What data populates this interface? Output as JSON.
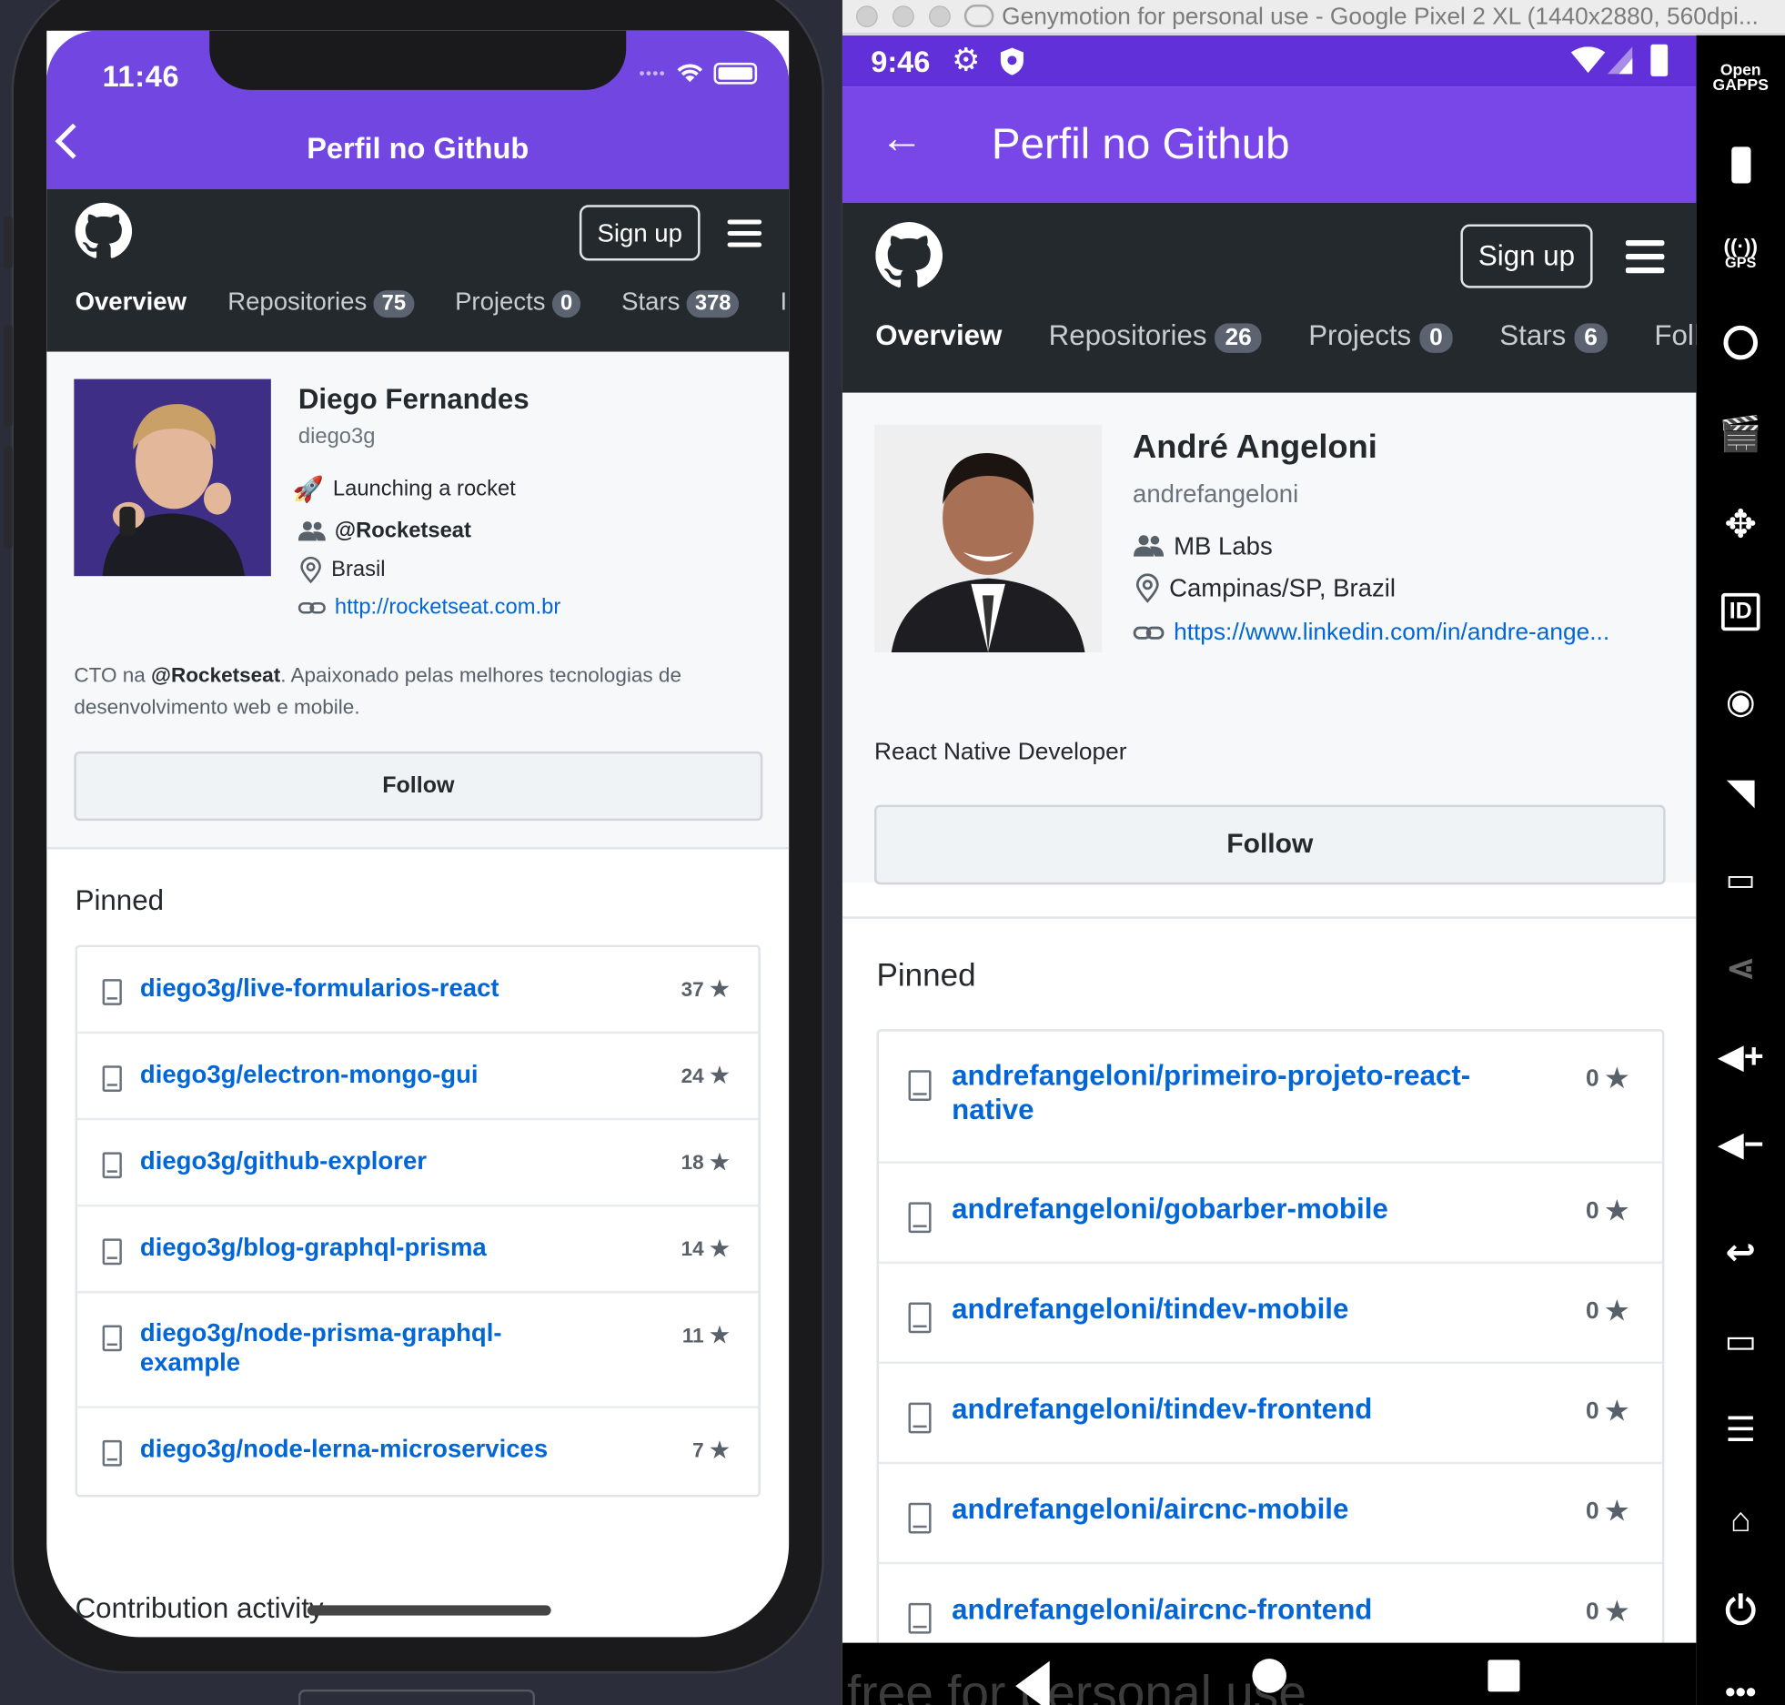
{
  "ios": {
    "time": "11:46",
    "title": "Perfil no Github",
    "signup": "Sign up",
    "tabs": [
      {
        "label": "Overview",
        "count": ""
      },
      {
        "label": "Repositories",
        "count": "75"
      },
      {
        "label": "Projects",
        "count": "0"
      },
      {
        "label": "Stars",
        "count": "378"
      },
      {
        "label": "I",
        "count": ""
      }
    ],
    "profile": {
      "name": "Diego Fernandes",
      "login": "diego3g",
      "status": "Launching a rocket",
      "org": "@Rocketseat",
      "location": "Brasil",
      "url": "http://rocketseat.com.br",
      "bio_prefix": "CTO na ",
      "bio_org": "@Rocketseat",
      "bio_suffix": ". Apaixonado pelas melhores tecnologias de",
      "bio_line2": "desenvolvimento web e mobile.",
      "follow": "Follow"
    },
    "pinned_title": "Pinned",
    "pinned": [
      {
        "name": "diego3g/live-formularios-react",
        "name2": "",
        "stars": "37"
      },
      {
        "name": "diego3g/electron-mongo-gui",
        "name2": "",
        "stars": "24"
      },
      {
        "name": "diego3g/github-explorer",
        "name2": "",
        "stars": "18"
      },
      {
        "name": "diego3g/blog-graphql-prisma",
        "name2": "",
        "stars": "14"
      },
      {
        "name": "diego3g/node-prisma-graphql-",
        "name2": "example",
        "stars": "11"
      },
      {
        "name": "diego3g/node-lerna-microservices",
        "name2": "",
        "stars": "7"
      }
    ],
    "contribution": "Contribution activity"
  },
  "android": {
    "window_title": "Genymotion for personal use - Google Pixel 2 XL (1440x2880, 560dpi...",
    "time": "9:46",
    "title": "Perfil no Github",
    "back": "←",
    "signup": "Sign up",
    "tabs": [
      {
        "label": "Overview",
        "count": ""
      },
      {
        "label": "Repositories",
        "count": "26"
      },
      {
        "label": "Projects",
        "count": "0"
      },
      {
        "label": "Stars",
        "count": "6"
      },
      {
        "label": "Follo",
        "count": ""
      }
    ],
    "profile": {
      "name": "André Angeloni",
      "login": "andrefangeloni",
      "org": "MB Labs",
      "location": "Campinas/SP, Brazil",
      "url": "https://www.linkedin.com/in/andre-ange...",
      "bio": "React Native Developer",
      "follow": "Follow"
    },
    "pinned_title": "Pinned",
    "pinned": [
      {
        "name": "andrefangeloni/primeiro-projeto-react-",
        "name2": "native",
        "stars": "0"
      },
      {
        "name": "andrefangeloni/gobarber-mobile",
        "name2": "",
        "stars": "0"
      },
      {
        "name": "andrefangeloni/tindev-mobile",
        "name2": "",
        "stars": "0"
      },
      {
        "name": "andrefangeloni/tindev-frontend",
        "name2": "",
        "stars": "0"
      },
      {
        "name": "andrefangeloni/aircnc-mobile",
        "name2": "",
        "stars": "0"
      },
      {
        "name": "andrefangeloni/aircnc-frontend",
        "name2": "",
        "stars": "0"
      }
    ],
    "navbar_text": "free for personal use"
  },
  "genymotion_side": {
    "open_gapps": "Open GAPPS",
    "gps": "GPS",
    "id": "ID"
  },
  "colors": {
    "header_purple": "#7247e1",
    "android_toolbar": "#7946e8",
    "github_dark": "#24292e",
    "link_blue": "#0366d6"
  }
}
